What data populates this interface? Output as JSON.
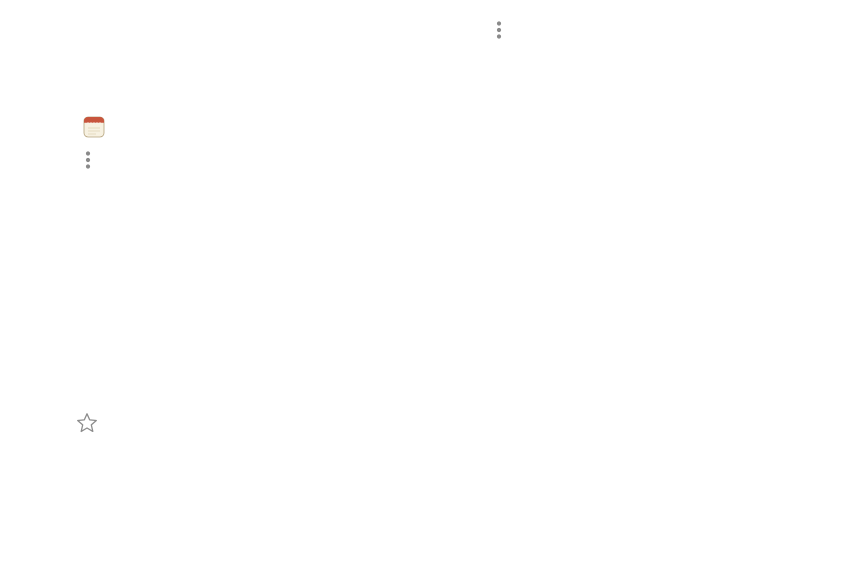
{
  "icons": {
    "notes_app": "notes-app-icon",
    "more_options_left": "more-options-icon",
    "more_options_right": "more-options-icon",
    "favorite": "star-outline-icon"
  },
  "colors": {
    "background": "#ffffff",
    "notes_header": "#c8553d",
    "notes_body": "#f7f1e1",
    "notes_outline": "#b5a37e",
    "dots": "#8a8a8a",
    "star_outline": "#8c8c8c"
  }
}
